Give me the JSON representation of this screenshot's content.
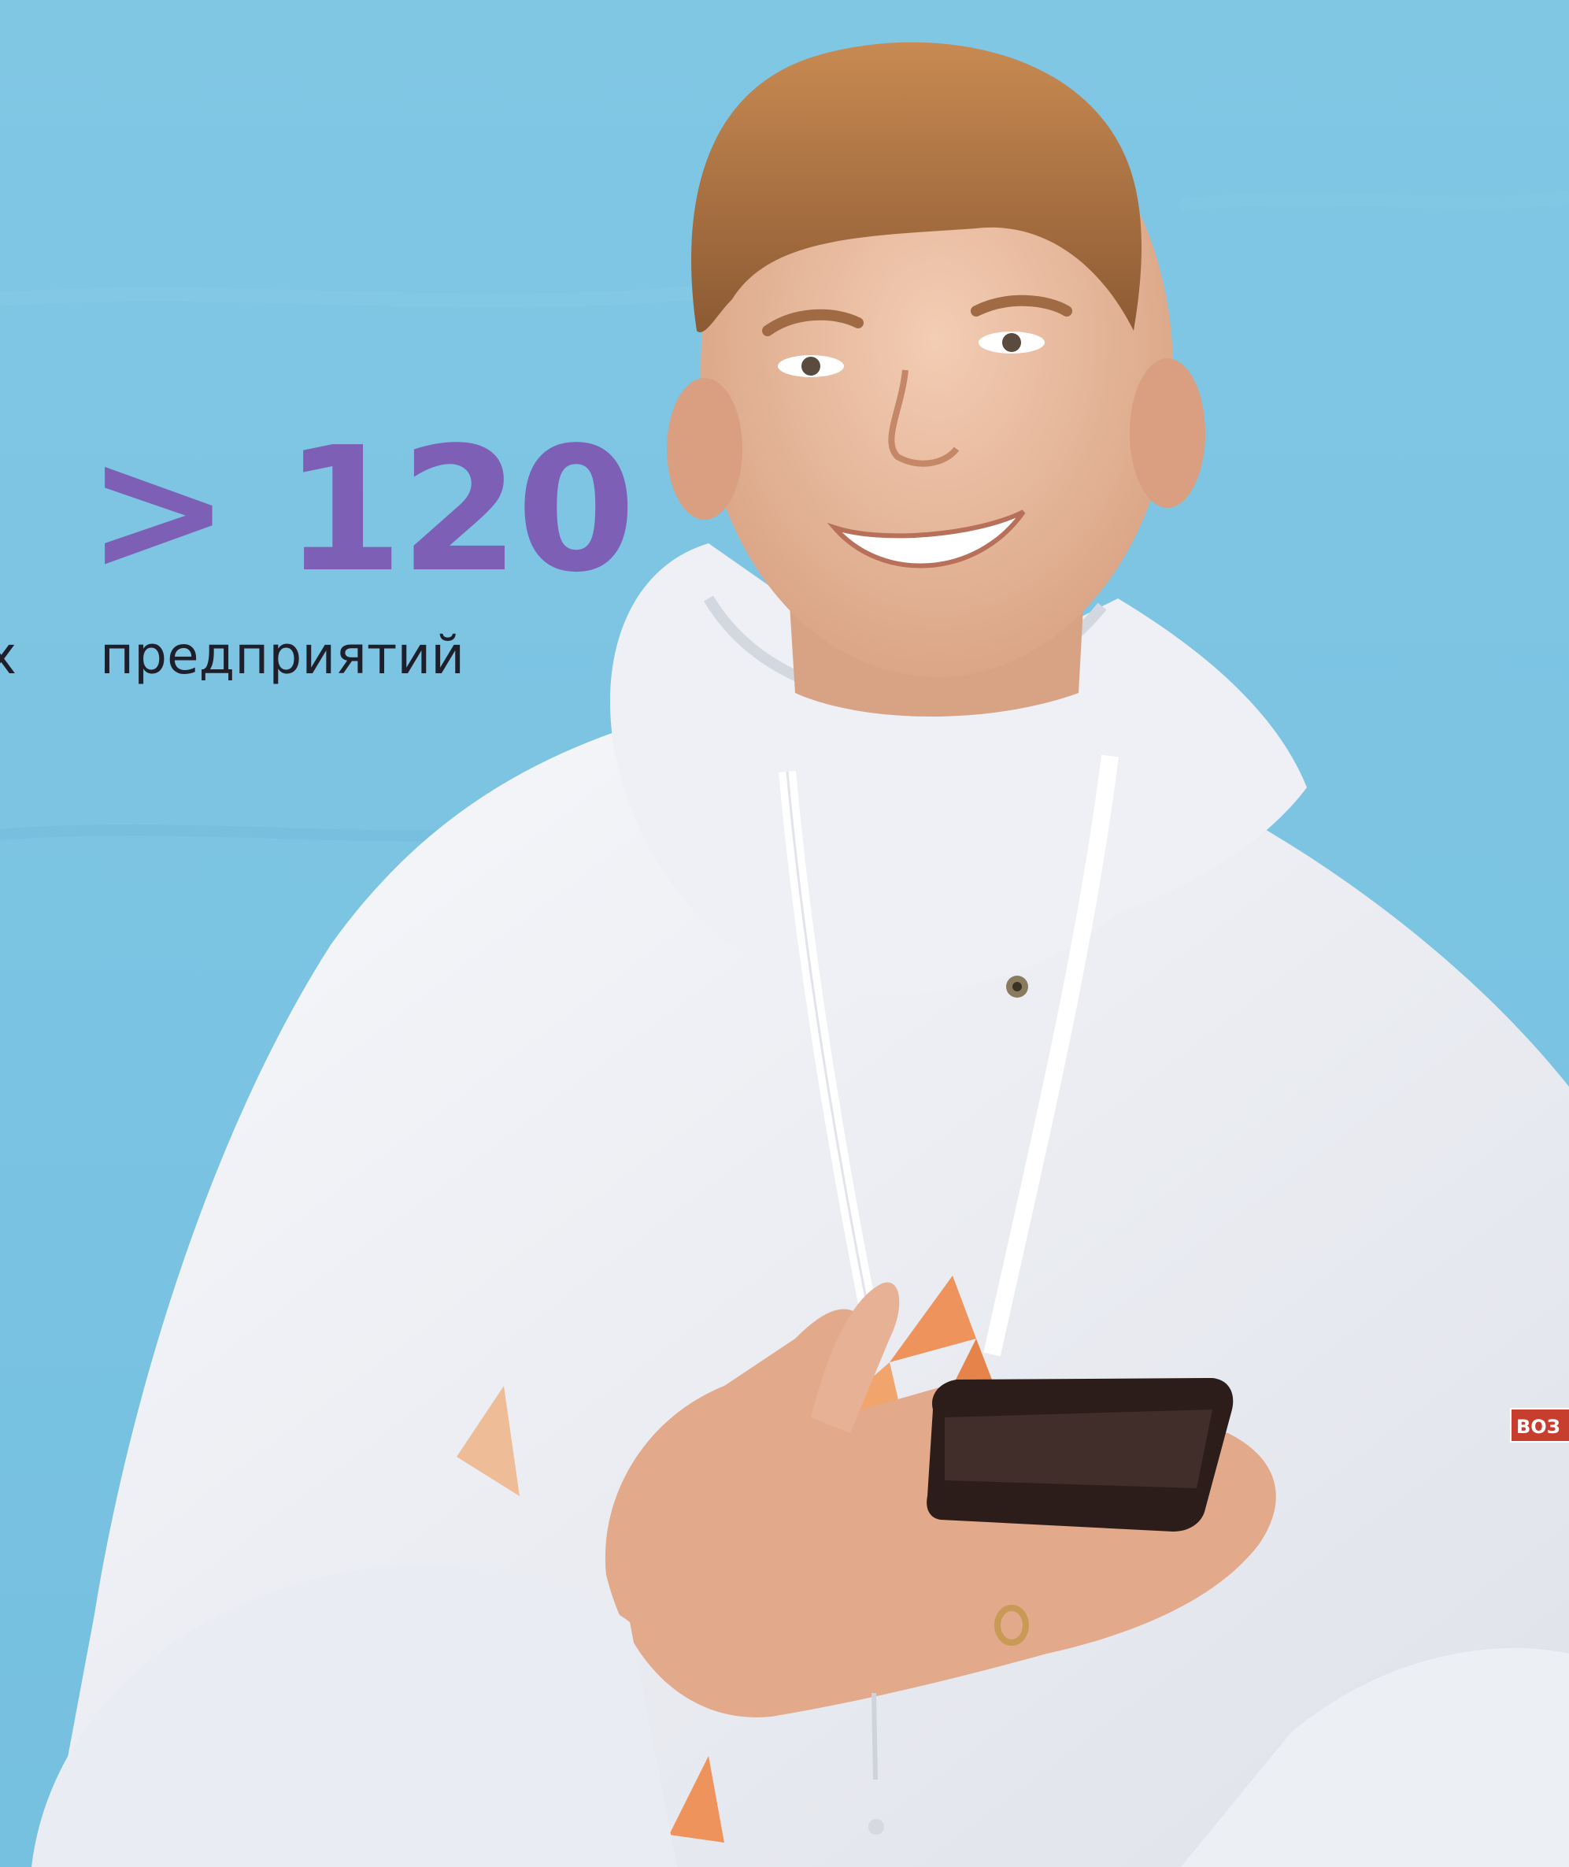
{
  "stat": {
    "value": "> 120",
    "label": "предприятий"
  },
  "edge_text": "х",
  "sleeve_badge": "ВОЗ",
  "colors": {
    "background": "#7bc4e3",
    "accent_number": "#7d60b6",
    "label_text": "#1f1f2b",
    "hoodie": "#f1f3f7",
    "skin": "#e9b89a",
    "hair": "#b77a45",
    "logo_orange": "#ee8a4a",
    "badge_red": "#c73e2f"
  },
  "photo": {
    "subject": "smiling young man in white hoodie holding a smartphone"
  }
}
